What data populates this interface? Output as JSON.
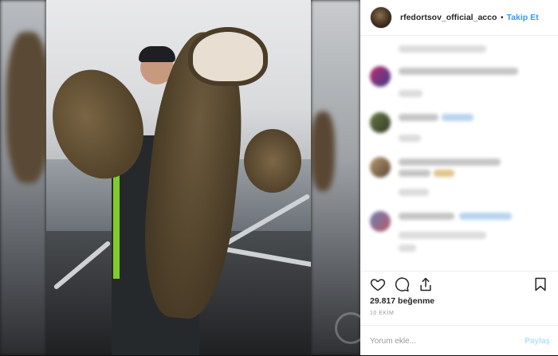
{
  "header": {
    "username": "rfedortsov_official_accou",
    "separator": "•",
    "follow_label": "Takip Et"
  },
  "post": {
    "likes_label": "29.817 beğenme",
    "date_label": "10 EKİM"
  },
  "comment_box": {
    "placeholder": "Yorum ekle...",
    "post_label": "Paylaş"
  },
  "icons": {
    "like": "heart-icon",
    "comment": "comment-icon",
    "share": "share-icon",
    "save": "bookmark-icon"
  },
  "colors": {
    "accent": "#3897f0",
    "post_disabled": "#b2dffc",
    "text": "#262626",
    "muted": "#999999"
  }
}
